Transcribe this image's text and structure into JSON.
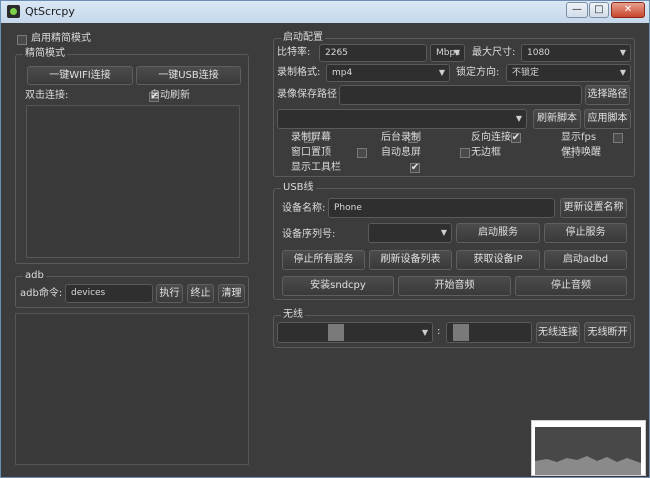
{
  "window": {
    "title": "QtScrcpy"
  },
  "simple_mode": {
    "checkbox_label": "启用精简模式",
    "group_title": "精简模式",
    "wifi_button": "一键WIFI连接",
    "usb_button": "一键USB连接",
    "doubleclick_label": "双击连接:",
    "auto_refresh_label": "自动刷新"
  },
  "adb": {
    "group_title": "adb",
    "cmd_label": "adb命令:",
    "cmd_value": "devices",
    "exec_button": "执行",
    "stop_button": "终止",
    "clear_button": "清理"
  },
  "startup": {
    "group_title": "启动配置",
    "bitrate_label": "比特率:",
    "bitrate_value": "2265",
    "bitrate_unit": "Mbps",
    "maxsize_label": "最大尺寸:",
    "maxsize_value": "1080",
    "record_format_label": "录制格式:",
    "record_format_value": "mp4",
    "lock_orientation_label": "锁定方向:",
    "lock_orientation_value": "不锁定",
    "record_path_label": "录像保存路径",
    "select_path_button": "选择路径",
    "refresh_script_button": "刷新脚本",
    "apply_script_button": "应用脚本",
    "options": [
      {
        "label": "录制屏幕",
        "checked": false
      },
      {
        "label": "后台录制",
        "checked": false
      },
      {
        "label": "反向连接",
        "checked": true
      },
      {
        "label": "显示fps",
        "checked": false
      },
      {
        "label": "窗口置顶",
        "checked": false
      },
      {
        "label": "自动息屏",
        "checked": false
      },
      {
        "label": "无边框",
        "checked": false
      },
      {
        "label": "保持唤醒",
        "checked": false
      },
      {
        "label": "显示工具栏",
        "checked": true
      }
    ]
  },
  "usb": {
    "group_title": "USB线",
    "device_name_label": "设备名称:",
    "device_name_value": "Phone",
    "update_name_button": "更新设置名称",
    "serial_label": "设备序列号:",
    "start_service_button": "启动服务",
    "stop_service_button": "停止服务",
    "stop_all_button": "停止所有服务",
    "refresh_devices_button": "刷新设备列表",
    "get_ip_button": "获取设备IP",
    "start_adbd_button": "启动adbd",
    "install_sndcpy_button": "安装sndcpy",
    "start_audio_button": "开始音频",
    "stop_audio_button": "停止音频"
  },
  "wireless": {
    "group_title": "无线",
    "colon": ":",
    "connect_button": "无线连接",
    "disconnect_button": "无线断开"
  },
  "window_buttons": {
    "minimize": "—",
    "maximize": "□",
    "close": "✕"
  }
}
